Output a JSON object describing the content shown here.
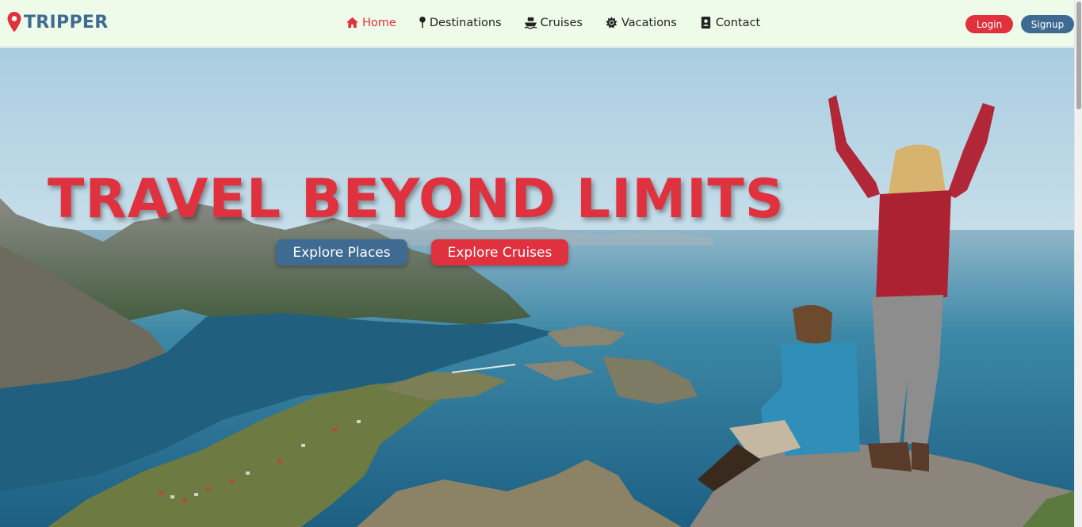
{
  "brand": {
    "name": "TRIPPER",
    "icon": "map-pin-icon",
    "color": "#3f6b92"
  },
  "nav": {
    "items": [
      {
        "label": "Home",
        "icon": "home-icon",
        "active": true
      },
      {
        "label": "Destinations",
        "icon": "map-pin-icon",
        "active": false
      },
      {
        "label": "Cruises",
        "icon": "ship-icon",
        "active": false
      },
      {
        "label": "Vacations",
        "icon": "sun-icon",
        "active": false
      },
      {
        "label": "Contact",
        "icon": "contact-book-icon",
        "active": false
      }
    ]
  },
  "auth": {
    "login_label": "Login",
    "signup_label": "Signup"
  },
  "hero": {
    "title": "TRAVEL BEYOND LIMITS",
    "buttons": {
      "places_label": "Explore Places",
      "cruises_label": "Explore Cruises"
    }
  },
  "colors": {
    "accent_red": "#e0313f",
    "accent_blue": "#3f6b92",
    "navbar_bg": "#eefbe9"
  }
}
